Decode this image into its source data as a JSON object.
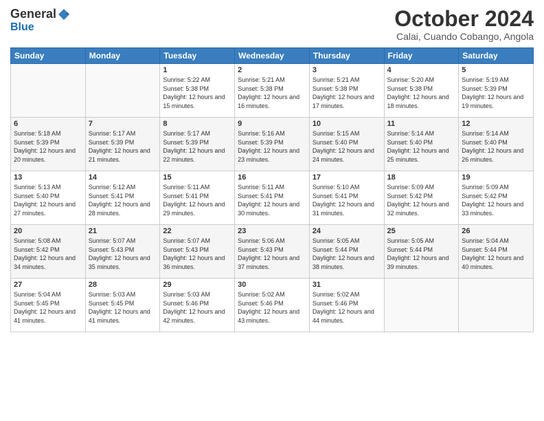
{
  "header": {
    "logo": {
      "general": "General",
      "blue": "Blue"
    },
    "title": "October 2024",
    "location": "Calai, Cuando Cobango, Angola"
  },
  "weekdays": [
    "Sunday",
    "Monday",
    "Tuesday",
    "Wednesday",
    "Thursday",
    "Friday",
    "Saturday"
  ],
  "weeks": [
    [
      {
        "day": "",
        "info": ""
      },
      {
        "day": "",
        "info": ""
      },
      {
        "day": "1",
        "info": "Sunrise: 5:22 AM\nSunset: 5:38 PM\nDaylight: 12 hours and 15 minutes."
      },
      {
        "day": "2",
        "info": "Sunrise: 5:21 AM\nSunset: 5:38 PM\nDaylight: 12 hours and 16 minutes."
      },
      {
        "day": "3",
        "info": "Sunrise: 5:21 AM\nSunset: 5:38 PM\nDaylight: 12 hours and 17 minutes."
      },
      {
        "day": "4",
        "info": "Sunrise: 5:20 AM\nSunset: 5:38 PM\nDaylight: 12 hours and 18 minutes."
      },
      {
        "day": "5",
        "info": "Sunrise: 5:19 AM\nSunset: 5:39 PM\nDaylight: 12 hours and 19 minutes."
      }
    ],
    [
      {
        "day": "6",
        "info": "Sunrise: 5:18 AM\nSunset: 5:39 PM\nDaylight: 12 hours and 20 minutes."
      },
      {
        "day": "7",
        "info": "Sunrise: 5:17 AM\nSunset: 5:39 PM\nDaylight: 12 hours and 21 minutes."
      },
      {
        "day": "8",
        "info": "Sunrise: 5:17 AM\nSunset: 5:39 PM\nDaylight: 12 hours and 22 minutes."
      },
      {
        "day": "9",
        "info": "Sunrise: 5:16 AM\nSunset: 5:39 PM\nDaylight: 12 hours and 23 minutes."
      },
      {
        "day": "10",
        "info": "Sunrise: 5:15 AM\nSunset: 5:40 PM\nDaylight: 12 hours and 24 minutes."
      },
      {
        "day": "11",
        "info": "Sunrise: 5:14 AM\nSunset: 5:40 PM\nDaylight: 12 hours and 25 minutes."
      },
      {
        "day": "12",
        "info": "Sunrise: 5:14 AM\nSunset: 5:40 PM\nDaylight: 12 hours and 26 minutes."
      }
    ],
    [
      {
        "day": "13",
        "info": "Sunrise: 5:13 AM\nSunset: 5:40 PM\nDaylight: 12 hours and 27 minutes."
      },
      {
        "day": "14",
        "info": "Sunrise: 5:12 AM\nSunset: 5:41 PM\nDaylight: 12 hours and 28 minutes."
      },
      {
        "day": "15",
        "info": "Sunrise: 5:11 AM\nSunset: 5:41 PM\nDaylight: 12 hours and 29 minutes."
      },
      {
        "day": "16",
        "info": "Sunrise: 5:11 AM\nSunset: 5:41 PM\nDaylight: 12 hours and 30 minutes."
      },
      {
        "day": "17",
        "info": "Sunrise: 5:10 AM\nSunset: 5:41 PM\nDaylight: 12 hours and 31 minutes."
      },
      {
        "day": "18",
        "info": "Sunrise: 5:09 AM\nSunset: 5:42 PM\nDaylight: 12 hours and 32 minutes."
      },
      {
        "day": "19",
        "info": "Sunrise: 5:09 AM\nSunset: 5:42 PM\nDaylight: 12 hours and 33 minutes."
      }
    ],
    [
      {
        "day": "20",
        "info": "Sunrise: 5:08 AM\nSunset: 5:42 PM\nDaylight: 12 hours and 34 minutes."
      },
      {
        "day": "21",
        "info": "Sunrise: 5:07 AM\nSunset: 5:43 PM\nDaylight: 12 hours and 35 minutes."
      },
      {
        "day": "22",
        "info": "Sunrise: 5:07 AM\nSunset: 5:43 PM\nDaylight: 12 hours and 36 minutes."
      },
      {
        "day": "23",
        "info": "Sunrise: 5:06 AM\nSunset: 5:43 PM\nDaylight: 12 hours and 37 minutes."
      },
      {
        "day": "24",
        "info": "Sunrise: 5:05 AM\nSunset: 5:44 PM\nDaylight: 12 hours and 38 minutes."
      },
      {
        "day": "25",
        "info": "Sunrise: 5:05 AM\nSunset: 5:44 PM\nDaylight: 12 hours and 39 minutes."
      },
      {
        "day": "26",
        "info": "Sunrise: 5:04 AM\nSunset: 5:44 PM\nDaylight: 12 hours and 40 minutes."
      }
    ],
    [
      {
        "day": "27",
        "info": "Sunrise: 5:04 AM\nSunset: 5:45 PM\nDaylight: 12 hours and 41 minutes."
      },
      {
        "day": "28",
        "info": "Sunrise: 5:03 AM\nSunset: 5:45 PM\nDaylight: 12 hours and 41 minutes."
      },
      {
        "day": "29",
        "info": "Sunrise: 5:03 AM\nSunset: 5:46 PM\nDaylight: 12 hours and 42 minutes."
      },
      {
        "day": "30",
        "info": "Sunrise: 5:02 AM\nSunset: 5:46 PM\nDaylight: 12 hours and 43 minutes."
      },
      {
        "day": "31",
        "info": "Sunrise: 5:02 AM\nSunset: 5:46 PM\nDaylight: 12 hours and 44 minutes."
      },
      {
        "day": "",
        "info": ""
      },
      {
        "day": "",
        "info": ""
      }
    ]
  ]
}
